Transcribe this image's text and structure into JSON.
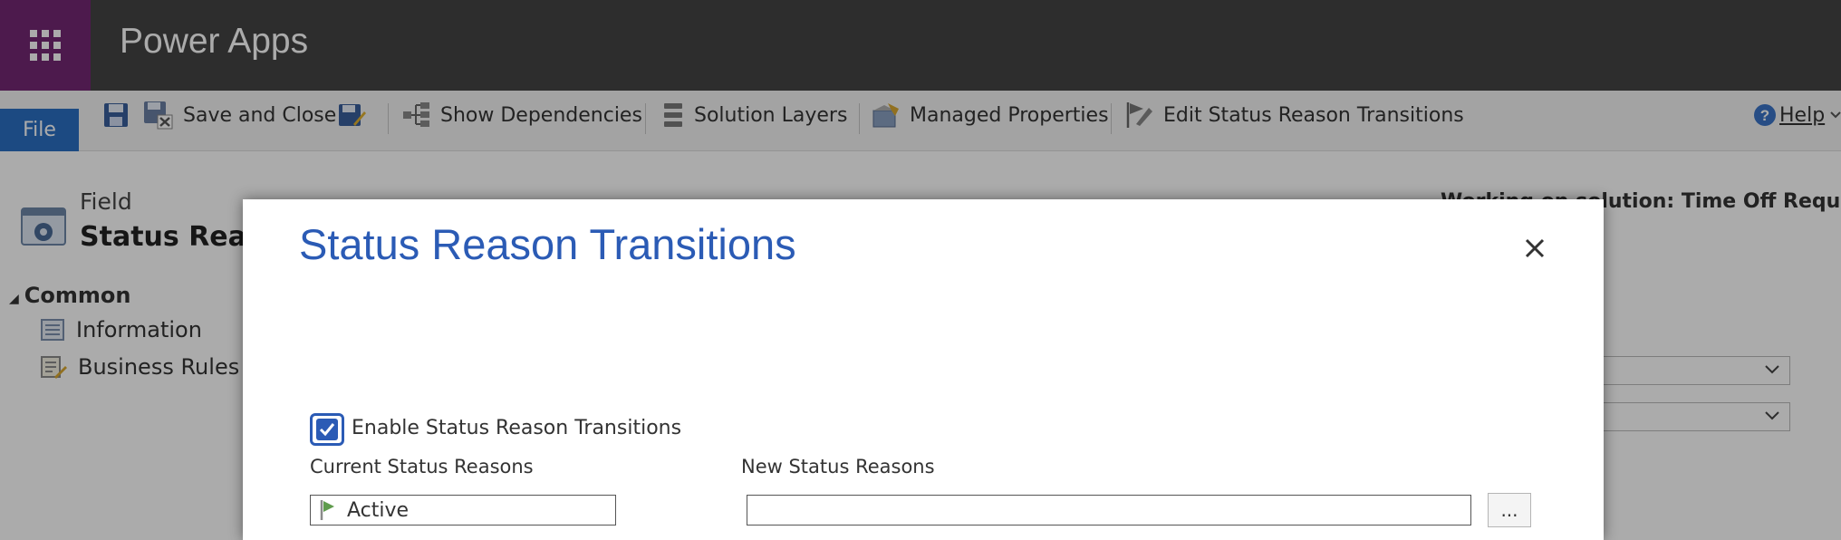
{
  "app": {
    "title": "Power Apps"
  },
  "ribbon": {
    "file_label": "File",
    "save_and_close": "Save and Close",
    "show_dependencies": "Show Dependencies",
    "solution_layers": "Solution Layers",
    "managed_properties": "Managed Properties",
    "edit_status_reason_transitions": "Edit Status Reason Transitions",
    "help": "Help"
  },
  "page": {
    "field_label": "Field",
    "field_name": "Status Reason",
    "working_on_solution": "Working on solution: Time Off Request"
  },
  "nav": {
    "section": "Common",
    "items": [
      {
        "label": "Information",
        "icon": "information-icon"
      },
      {
        "label": "Business Rules",
        "icon": "business-rules-icon"
      }
    ]
  },
  "dialog": {
    "title": "Status Reason Transitions",
    "enable_label": "Enable Status Reason Transitions",
    "enable_checked": true,
    "current_header": "Current Status Reasons",
    "new_header": "New Status Reasons",
    "current_value": "Active",
    "new_value": "",
    "browse_label": "..."
  },
  "colors": {
    "topbar": "#444444",
    "waffle": "#742774",
    "accent": "#2b5bb5",
    "file_button": "#2b6fc2"
  }
}
